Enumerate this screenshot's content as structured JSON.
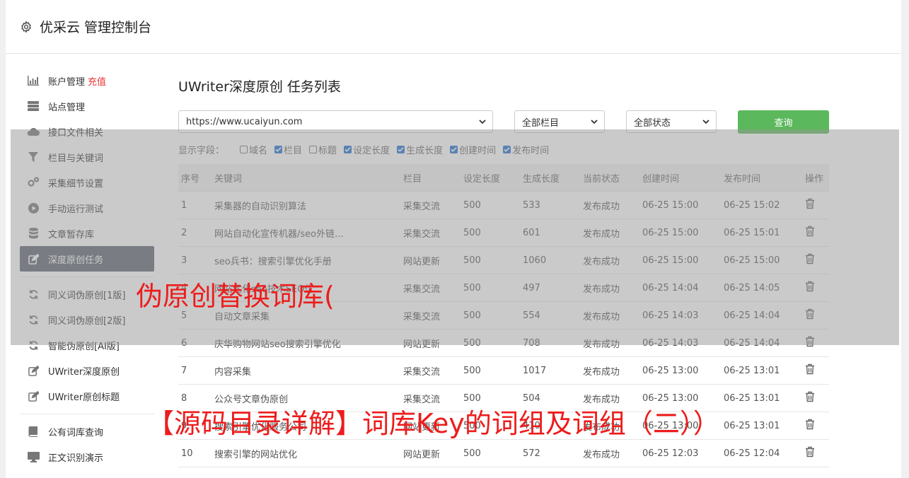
{
  "header": {
    "title": "优采云 管理控制台"
  },
  "sidebar": {
    "items": [
      {
        "label": "账户管理",
        "badge": "充值",
        "icon": "bar-chart-icon"
      },
      {
        "label": "站点管理",
        "icon": "server-icon"
      },
      {
        "label": "接口文件相关",
        "icon": "cloud-upload-icon"
      },
      {
        "label": "栏目与关键词",
        "icon": "filter-icon"
      },
      {
        "label": "采集细节设置",
        "icon": "gears-icon"
      },
      {
        "label": "手动运行测试",
        "icon": "play-circle-icon"
      },
      {
        "label": "文章暂存库",
        "icon": "database-icon"
      },
      {
        "label": "深度原创任务",
        "icon": "edit-icon",
        "active": true
      },
      {
        "label": "同义词伪原创[1版]",
        "icon": "refresh-icon"
      },
      {
        "label": "同义词伪原创[2版]",
        "icon": "refresh-icon"
      },
      {
        "label": "智能伪原创[AI版]",
        "icon": "refresh-icon"
      },
      {
        "label": "UWriter深度原创",
        "icon": "edit-icon"
      },
      {
        "label": "UWriter原创标题",
        "icon": "edit-icon"
      },
      {
        "label": "公有词库查询",
        "icon": "book-icon"
      },
      {
        "label": "正文识别演示",
        "icon": "monitor-icon"
      }
    ]
  },
  "main": {
    "title": "UWriter深度原创 任务列表",
    "site_select": "https://www.ucaiyun.com",
    "column_select": "全部栏目",
    "status_select": "全部状态",
    "query_label": "查询",
    "fields_label": "显示字段：",
    "fields": [
      {
        "label": "域名",
        "checked": false
      },
      {
        "label": "栏目",
        "checked": true
      },
      {
        "label": "标题",
        "checked": false
      },
      {
        "label": "设定长度",
        "checked": true
      },
      {
        "label": "生成长度",
        "checked": true
      },
      {
        "label": "创建时间",
        "checked": true
      },
      {
        "label": "发布时间",
        "checked": true
      }
    ],
    "table": {
      "headers": [
        "序号",
        "关键词",
        "栏目",
        "设定长度",
        "生成长度",
        "当前状态",
        "创建时间",
        "发布时间",
        "操作"
      ],
      "rows": [
        [
          "1",
          "采集器的自动识别算法",
          "采集交流",
          "500",
          "533",
          "发布成功",
          "06-25 15:00",
          "06-25 15:02"
        ],
        [
          "2",
          "网站自动化宣传机器/seo外链...",
          "采集交流",
          "500",
          "601",
          "发布成功",
          "06-25 15:00",
          "06-25 15:01"
        ],
        [
          "3",
          "seo兵书：搜索引擎优化手册",
          "网站更新",
          "500",
          "1060",
          "发布成功",
          "06-25 15:00",
          "06-25 15:00"
        ],
        [
          "4",
          "网站优化seo技术SEO优...",
          "采集交流",
          "500",
          "497",
          "发布成功",
          "06-25 14:04",
          "06-25 14:05"
        ],
        [
          "5",
          "自动文章采集",
          "采集交流",
          "500",
          "554",
          "发布成功",
          "06-25 14:03",
          "06-25 14:04"
        ],
        [
          "6",
          "庆华购物网站seo搜索引擎优化",
          "网站更新",
          "500",
          "708",
          "发布成功",
          "06-25 14:03",
          "06-25 14:04"
        ],
        [
          "7",
          "内容采集",
          "采集交流",
          "500",
          "1017",
          "发布成功",
          "06-25 13:00",
          "06-25 13:01"
        ],
        [
          "8",
          "公众号文章伪原创",
          "采集交流",
          "500",
          "504",
          "发布成功",
          "06-25 13:00",
          "06-25 13:01"
        ],
        [
          "9",
          "搜索引擎优化服务公司",
          "网站更新",
          "500",
          "410",
          "发布成功",
          "06-25 13:00",
          "06-25 13:01"
        ],
        [
          "10",
          "搜索引擎的网站优化",
          "网站更新",
          "500",
          "572",
          "发布成功",
          "06-25 12:03",
          "06-25 12:04"
        ]
      ]
    }
  },
  "overlay": {
    "caption1": "伪原创替换词库(",
    "caption2": "【源码目录详解】词库Key的词组及词组（二））"
  }
}
